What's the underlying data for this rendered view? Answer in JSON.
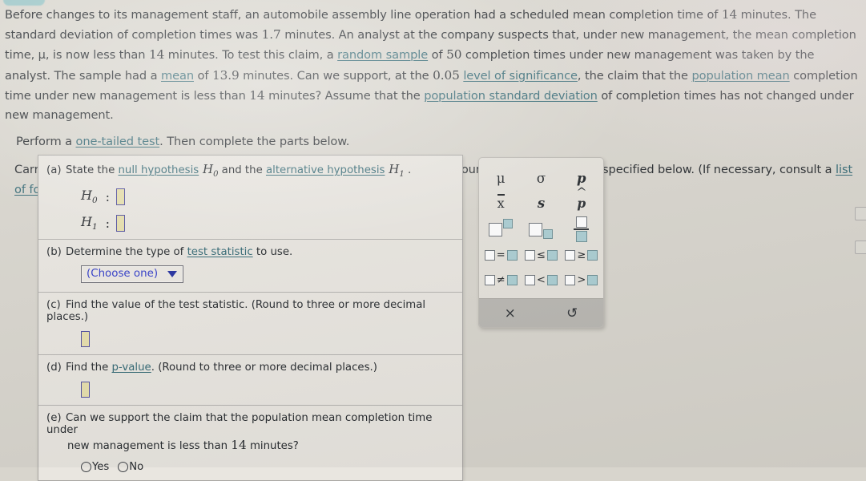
{
  "statement": {
    "paragraph_1_parts": [
      {
        "t": "Before changes to its management staff, an automobile assembly line operation had a scheduled mean completion time of "
      },
      {
        "t": "14",
        "k": "num"
      },
      {
        "t": " minutes. The standard deviation of completion times was "
      },
      {
        "t": "1.7",
        "k": "num"
      },
      {
        "t": " minutes. An analyst at the company suspects that, under new management, the mean completion time, "
      },
      {
        "t": "μ",
        "k": "mu"
      },
      {
        "t": ", is now less than "
      },
      {
        "t": "14",
        "k": "num"
      },
      {
        "t": " minutes. To test this claim, a "
      },
      {
        "t": "random sample",
        "k": "link"
      },
      {
        "t": " of "
      },
      {
        "t": "50",
        "k": "num"
      },
      {
        "t": " completion times under new management was taken by the analyst. The sample had a "
      },
      {
        "t": "mean",
        "k": "link"
      },
      {
        "t": " of "
      },
      {
        "t": "13.9",
        "k": "num"
      },
      {
        "t": " minutes. Can we support, at the "
      },
      {
        "t": "0.05",
        "k": "num"
      },
      {
        "t": " "
      },
      {
        "t": "level of significance",
        "k": "link"
      },
      {
        "t": ", the claim that the "
      },
      {
        "t": "population mean",
        "k": "link"
      },
      {
        "t": " completion time under new management is less than "
      },
      {
        "t": "14",
        "k": "num"
      },
      {
        "t": " minutes? Assume that the "
      },
      {
        "t": "population standard deviation",
        "k": "link"
      },
      {
        "t": " of completion times has not changed under new management."
      }
    ],
    "perform_line_parts": [
      {
        "t": "Perform a "
      },
      {
        "t": "one-tailed test",
        "k": "link"
      },
      {
        "t": ". Then complete the parts below."
      }
    ],
    "carry_line_parts": [
      {
        "t": "Carry your intermediate computations to three or more decimal places, and round your responses as specified below. (If necessary, consult a "
      },
      {
        "t": "list of formulas",
        "k": "link"
      },
      {
        "t": ".)"
      }
    ]
  },
  "parts": {
    "a": {
      "letter": "(a)",
      "text_before_link1": "State the ",
      "link1": "null hypothesis",
      "h0_symbol": "H",
      "h0_sub": "0",
      "text_middle": " and the ",
      "link2": "alternative hypothesis",
      "h1_symbol": "H",
      "h1_sub": "1",
      "text_after": " .",
      "h0_label": "H",
      "h0_label_sub": "0",
      "h1_label": "H",
      "h1_label_sub": "1",
      "colon": ":",
      "h0_value": "",
      "h1_value": ""
    },
    "b": {
      "letter": "(b)",
      "text_before_link": "Determine the type of ",
      "link": "test statistic",
      "text_after_link": " to use.",
      "select_value": "(Choose one)",
      "caret_icon": "chevron-down-icon"
    },
    "c": {
      "letter": "(c)",
      "text": "Find the value of the test statistic. (Round to three or more decimal places.)",
      "answer_value": ""
    },
    "d": {
      "letter": "(d)",
      "text_before_link": "Find the ",
      "link": "p-value",
      "text_after_link": ". (Round to three or more decimal places.)",
      "answer_value": ""
    },
    "e": {
      "letter": "(e)",
      "text_line1": "Can we support the claim that the population mean completion time under",
      "text_line2_before_num": "new management is less than ",
      "text_line2_num": "14",
      "text_line2_after_num": " minutes?",
      "options": [
        {
          "label": "Yes",
          "selected": false
        },
        {
          "label": "No",
          "selected": false
        }
      ]
    }
  },
  "keypad": {
    "rows": [
      [
        {
          "id": "mu",
          "glyph": "μ",
          "name": "mu-key"
        },
        {
          "id": "sigma",
          "glyph": "σ",
          "name": "sigma-key"
        },
        {
          "id": "p",
          "glyph": "p",
          "name": "p-key"
        }
      ],
      [
        {
          "id": "xbar",
          "glyph": "x",
          "name": "x-bar-key"
        },
        {
          "id": "s",
          "glyph": "s",
          "name": "s-key"
        },
        {
          "id": "phat",
          "glyph": "p",
          "name": "p-hat-key"
        }
      ],
      [
        {
          "id": "superscript",
          "glyph": "",
          "name": "superscript-template-key"
        },
        {
          "id": "subscript",
          "glyph": "",
          "name": "subscript-template-key"
        },
        {
          "id": "fraction",
          "glyph": "",
          "name": "fraction-template-key"
        }
      ],
      [
        {
          "id": "eq",
          "glyph": "=",
          "name": "equals-key"
        },
        {
          "id": "le",
          "glyph": "≤",
          "name": "less-than-or-equal-key"
        },
        {
          "id": "ge",
          "glyph": "≥",
          "name": "greater-than-or-equal-key"
        }
      ],
      [
        {
          "id": "ne",
          "glyph": "≠",
          "name": "not-equal-key"
        },
        {
          "id": "lt",
          "glyph": "<",
          "name": "less-than-key"
        },
        {
          "id": "gt",
          "glyph": ">",
          "name": "greater-than-key"
        }
      ]
    ],
    "footer": {
      "clear_icon": "×",
      "clear_name": "clear-icon",
      "undo_icon": "↺",
      "undo_name": "undo-icon"
    }
  },
  "colors": {
    "page_background": "#d8d5cd",
    "panel_background": "#e9e6e0",
    "link": "#2e6571",
    "answer_box_fill": "#e7dfab",
    "answer_box_border": "#4d4b9c",
    "select_text": "#2a35c8",
    "keypad_fill_box": "#a9cdd2",
    "keypad_footer": "#b8b6b1"
  }
}
